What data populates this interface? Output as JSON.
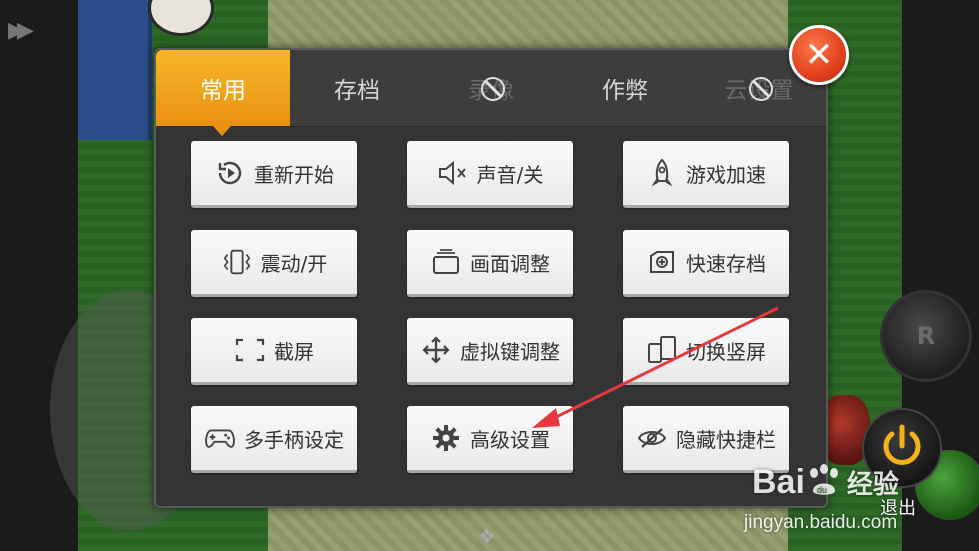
{
  "menu": {
    "tabs": [
      {
        "label": "常用",
        "active": true
      },
      {
        "label": "存档",
        "active": false
      },
      {
        "label": "录像",
        "active": false,
        "disabled": true
      },
      {
        "label": "作弊",
        "active": false
      },
      {
        "label": "云设置",
        "active": false,
        "disabled": true
      }
    ],
    "close_icon": "close-icon",
    "buttons": [
      {
        "label": "重新开始",
        "icon": "restart-icon"
      },
      {
        "label": "声音/关",
        "icon": "sound-off-icon"
      },
      {
        "label": "游戏加速",
        "icon": "rocket-icon"
      },
      {
        "label": "震动/开",
        "icon": "vibrate-icon"
      },
      {
        "label": "画面调整",
        "icon": "screen-adjust-icon"
      },
      {
        "label": "快速存档",
        "icon": "quick-save-icon"
      },
      {
        "label": "截屏",
        "icon": "screenshot-icon"
      },
      {
        "label": "虚拟键调整",
        "icon": "move-icon"
      },
      {
        "label": "切换竖屏",
        "icon": "rotate-screen-icon"
      },
      {
        "label": "多手柄设定",
        "icon": "gamepad-icon"
      },
      {
        "label": "高级设置",
        "icon": "gear-icon"
      },
      {
        "label": "隐藏快捷栏",
        "icon": "hide-eye-icon"
      }
    ]
  },
  "controls": {
    "r_button": "R",
    "exit_label": "退出"
  },
  "watermark": {
    "brand_left": "Bai",
    "brand_right": "经验",
    "url": "jingyan.baidu.com"
  },
  "colors": {
    "tab_active": "#f0a21a",
    "close": "#e0401c",
    "arrow": "#e8383d",
    "power": "#f2b21c"
  }
}
